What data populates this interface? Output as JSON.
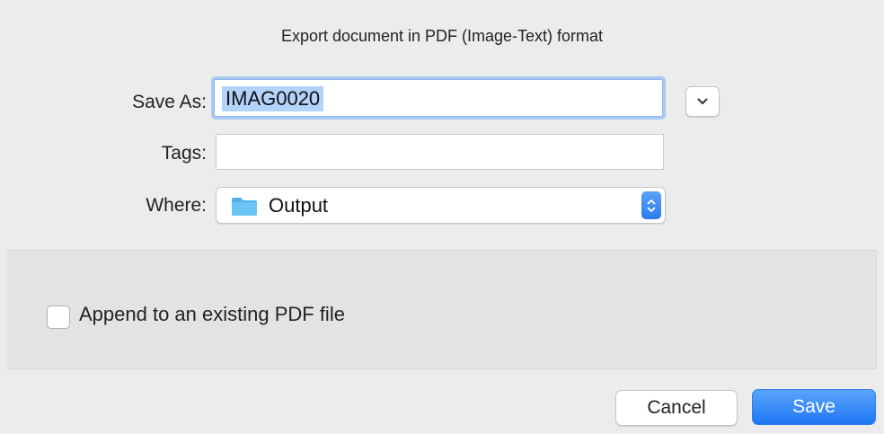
{
  "dialog": {
    "title": "Export document in PDF (Image-Text) format"
  },
  "save_as": {
    "label": "Save As:",
    "value": "IMAG0020",
    "expand_icon": "chevron-down-icon"
  },
  "tags": {
    "label": "Tags:",
    "value": ""
  },
  "where": {
    "label": "Where:",
    "selected": "Output",
    "icon": "folder-icon",
    "stepper_icon": "up-down-chevron-icon"
  },
  "options": {
    "append_label": "Append to an existing PDF file",
    "append_checked": false
  },
  "buttons": {
    "cancel": "Cancel",
    "save": "Save"
  },
  "colors": {
    "accent": "#2a7cf0",
    "selection": "#b3d3fb",
    "folder": "#5fb8f0"
  }
}
